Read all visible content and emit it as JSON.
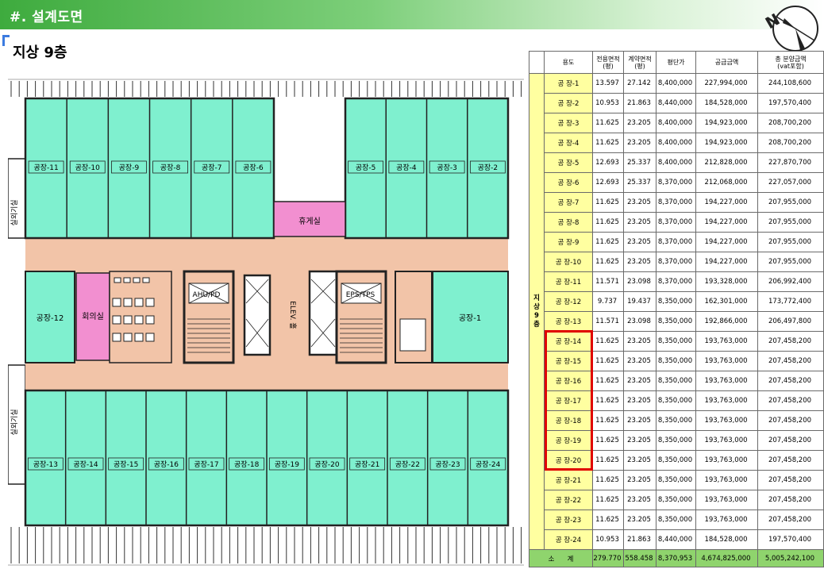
{
  "banner": {
    "title": "#. 설계도면"
  },
  "section": {
    "title": "지상 9층"
  },
  "plan": {
    "rooms_top_left": [
      "공장-11",
      "공장-10",
      "공장-9",
      "공장-8",
      "공장-7",
      "공장-6"
    ],
    "rooms_top_right": [
      "공장-5",
      "공장-4",
      "공장-3",
      "공장-2"
    ],
    "rooms_bottom": [
      "공장-13",
      "공장-14",
      "공장-15",
      "공장-16",
      "공장-17",
      "공장-18",
      "공장-19",
      "공장-20",
      "공장-21",
      "공장-22",
      "공장-23",
      "공장-24"
    ],
    "room_12": "공장-12",
    "room_1": "공장-1",
    "meeting_room": "회의실",
    "lounge": "휴게실",
    "ahu": "AHU/PD",
    "eps": "EPS/TPS",
    "elev_hall": "ELEV. 홀",
    "outdoor_unit": "실외기실"
  },
  "table": {
    "headers": {
      "use": "용도",
      "exclusive_area": "전용면적\n(평)",
      "contract_area": "계약면적\n(평)",
      "price_per_pyeong": "평단가",
      "supply_amount": "공급금액",
      "total_price": "총 분양금액\n(vat포함)"
    },
    "floor_label": "지\n상\n9\n층",
    "rows": [
      {
        "use": "공 장-1",
        "exclusive": "13.597",
        "contract": "27.142",
        "price": "8,400,000",
        "supply": "227,994,000",
        "total": "244,108,600"
      },
      {
        "use": "공 장-2",
        "exclusive": "10.953",
        "contract": "21.863",
        "price": "8,440,000",
        "supply": "184,528,000",
        "total": "197,570,400"
      },
      {
        "use": "공 장-3",
        "exclusive": "11.625",
        "contract": "23.205",
        "price": "8,400,000",
        "supply": "194,923,000",
        "total": "208,700,200"
      },
      {
        "use": "공 장-4",
        "exclusive": "11.625",
        "contract": "23.205",
        "price": "8,400,000",
        "supply": "194,923,000",
        "total": "208,700,200"
      },
      {
        "use": "공 장-5",
        "exclusive": "12.693",
        "contract": "25.337",
        "price": "8,400,000",
        "supply": "212,828,000",
        "total": "227,870,700"
      },
      {
        "use": "공 장-6",
        "exclusive": "12.693",
        "contract": "25.337",
        "price": "8,370,000",
        "supply": "212,068,000",
        "total": "227,057,000"
      },
      {
        "use": "공 장-7",
        "exclusive": "11.625",
        "contract": "23.205",
        "price": "8,370,000",
        "supply": "194,227,000",
        "total": "207,955,000"
      },
      {
        "use": "공 장-8",
        "exclusive": "11.625",
        "contract": "23.205",
        "price": "8,370,000",
        "supply": "194,227,000",
        "total": "207,955,000"
      },
      {
        "use": "공 장-9",
        "exclusive": "11.625",
        "contract": "23.205",
        "price": "8,370,000",
        "supply": "194,227,000",
        "total": "207,955,000"
      },
      {
        "use": "공 장-10",
        "exclusive": "11.625",
        "contract": "23.205",
        "price": "8,370,000",
        "supply": "194,227,000",
        "total": "207,955,000"
      },
      {
        "use": "공 장-11",
        "exclusive": "11.571",
        "contract": "23.098",
        "price": "8,370,000",
        "supply": "193,328,000",
        "total": "206,992,400"
      },
      {
        "use": "공 장-12",
        "exclusive": "9.737",
        "contract": "19.437",
        "price": "8,350,000",
        "supply": "162,301,000",
        "total": "173,772,400"
      },
      {
        "use": "공 장-13",
        "exclusive": "11.571",
        "contract": "23.098",
        "price": "8,350,000",
        "supply": "192,866,000",
        "total": "206,497,800"
      },
      {
        "use": "공 장-14",
        "exclusive": "11.625",
        "contract": "23.205",
        "price": "8,350,000",
        "supply": "193,763,000",
        "total": "207,458,200"
      },
      {
        "use": "공 장-15",
        "exclusive": "11.625",
        "contract": "23.205",
        "price": "8,350,000",
        "supply": "193,763,000",
        "total": "207,458,200"
      },
      {
        "use": "공 장-16",
        "exclusive": "11.625",
        "contract": "23.205",
        "price": "8,350,000",
        "supply": "193,763,000",
        "total": "207,458,200"
      },
      {
        "use": "공 장-17",
        "exclusive": "11.625",
        "contract": "23.205",
        "price": "8,350,000",
        "supply": "193,763,000",
        "total": "207,458,200"
      },
      {
        "use": "공 장-18",
        "exclusive": "11.625",
        "contract": "23.205",
        "price": "8,350,000",
        "supply": "193,763,000",
        "total": "207,458,200"
      },
      {
        "use": "공 장-19",
        "exclusive": "11.625",
        "contract": "23.205",
        "price": "8,350,000",
        "supply": "193,763,000",
        "total": "207,458,200"
      },
      {
        "use": "공 장-20",
        "exclusive": "11.625",
        "contract": "23.205",
        "price": "8,350,000",
        "supply": "193,763,000",
        "total": "207,458,200"
      },
      {
        "use": "공 장-21",
        "exclusive": "11.625",
        "contract": "23.205",
        "price": "8,350,000",
        "supply": "193,763,000",
        "total": "207,458,200"
      },
      {
        "use": "공 장-22",
        "exclusive": "11.625",
        "contract": "23.205",
        "price": "8,350,000",
        "supply": "193,763,000",
        "total": "207,458,200"
      },
      {
        "use": "공 장-23",
        "exclusive": "11.625",
        "contract": "23.205",
        "price": "8,350,000",
        "supply": "193,763,000",
        "total": "207,458,200"
      },
      {
        "use": "공 장-24",
        "exclusive": "10.953",
        "contract": "21.863",
        "price": "8,440,000",
        "supply": "184,528,000",
        "total": "197,570,400"
      }
    ],
    "sum": {
      "label": "소      계",
      "exclusive": "279.770",
      "contract": "558.458",
      "price": "8,370,953",
      "supply": "4,674,825,000",
      "total": "5,005,242,100"
    }
  },
  "colors": {
    "room_fill": "#7ff0cf",
    "corridor_fill": "#f2c4a8",
    "pink_fill": "#f28fd0",
    "wall": "#222222",
    "yellow_cell": "#ffffa0",
    "sum_fill": "#8fd46d",
    "highlight": "#e00000"
  }
}
